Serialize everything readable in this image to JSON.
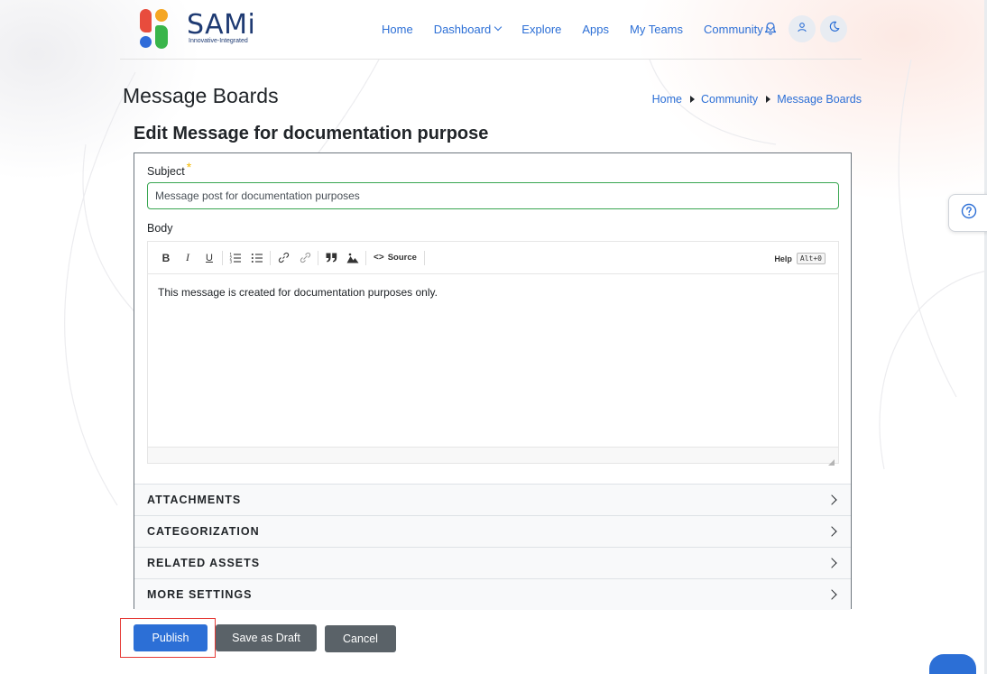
{
  "brand": {
    "name": "SAMi",
    "tagline": "Innovative-Integrated",
    "colors": {
      "red": "#e84c3d",
      "orange": "#f5a623",
      "blue": "#2f6bd9",
      "green": "#39b54a",
      "text": "#1f3b73"
    }
  },
  "nav": {
    "items": [
      {
        "label": "Home",
        "dropdown": false
      },
      {
        "label": "Dashboard",
        "dropdown": true
      },
      {
        "label": "Explore",
        "dropdown": false
      },
      {
        "label": "Apps",
        "dropdown": false
      },
      {
        "label": "My Teams",
        "dropdown": false
      },
      {
        "label": "Community",
        "dropdown": true
      }
    ],
    "icons": [
      "bell-icon",
      "user-icon",
      "moon-icon"
    ]
  },
  "page": {
    "title": "Message Boards"
  },
  "breadcrumb": {
    "items": [
      "Home",
      "Community",
      "Message Boards"
    ]
  },
  "form": {
    "title": "Edit Message for documentation purpose",
    "subject_label": "Subject",
    "required_mark": "*",
    "subject_value": "Message post for documentation purposes",
    "body_label": "Body",
    "body_text": "This message is created for documentation purposes only.",
    "toolbar": {
      "bold": "B",
      "italic": "I",
      "underline": "U",
      "source": "Source",
      "help": "Help",
      "help_shortcut": "Alt+0"
    },
    "sections": [
      "ATTACHMENTS",
      "CATEGORIZATION",
      "RELATED ASSETS",
      "MORE SETTINGS"
    ]
  },
  "actions": {
    "publish": "Publish",
    "save_draft": "Save as Draft",
    "cancel": "Cancel"
  },
  "colors": {
    "primary": "#2c6fd6",
    "secondary": "#5a6268",
    "valid": "#39a651",
    "highlight": "#e53935"
  }
}
